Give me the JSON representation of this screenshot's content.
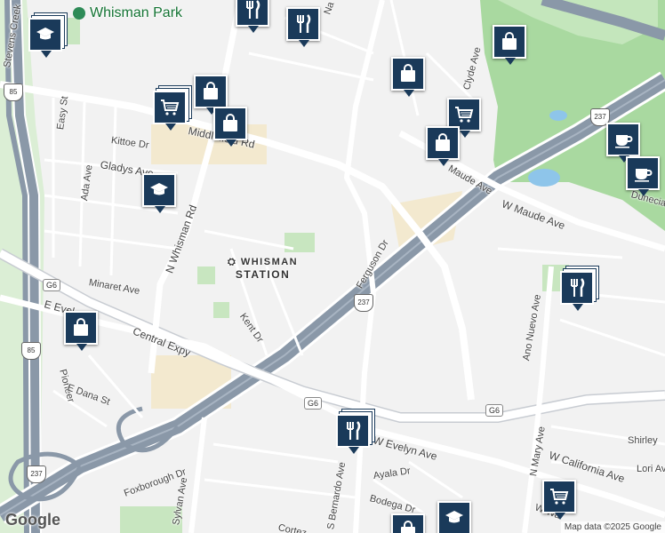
{
  "map": {
    "places": {
      "park": "Whisman Park",
      "station_line1": "WHISMAN",
      "station_line2": "STATION"
    },
    "streets": {
      "middlefield": "Middlefield Rd",
      "kittoe": "Kittoe Dr",
      "gladys": "Gladys Ave",
      "ada": "Ada Ave",
      "easy": "Easy St",
      "n_whisman": "N Whisman Rd",
      "minaret": "Minaret Ave",
      "e_evelyn_left": "E Evel",
      "central": "Central Expy",
      "kent": "Kent Dr",
      "pioneer": "Pioneer",
      "e_dana": "E Dana St",
      "foxborough": "Foxborough Dr",
      "sylvan": "Sylvan Ave",
      "s_bernardo": "S Bernardo Ave",
      "w_evelyn": "W Evelyn Ave",
      "ayala": "Ayala Dr",
      "bodega": "Bodega Dr",
      "cortez": "Cortez",
      "ferguson": "Ferguson Dr",
      "w_maude": "W Maude Ave",
      "maude": "Maude Ave",
      "clyde": "Clyde Ave",
      "ano_nuevo": "Ano Nuevo Ave",
      "n_mary": "N Mary Ave",
      "w_california": "W California Ave",
      "shirley": "Shirley",
      "lori": "Lori Av",
      "w_wash": "W Wa",
      "stevens_creek": "Stevens Creek",
      "na_top": "Na",
      "dunecia": "Dunecia"
    },
    "shields": {
      "hwy85_top": "85",
      "hwy85_bottom": "85",
      "hwy237_top": "237",
      "hwy237_mid": "237",
      "hwy237_bottom": "237",
      "g6_left": "G6",
      "g6_mid": "G6",
      "g6_right": "G6"
    },
    "pins": [
      {
        "name": "school-pin-1",
        "icon": "school"
      },
      {
        "name": "shopping-bag-pin-1",
        "icon": "bag"
      },
      {
        "name": "cart-pin-1",
        "icon": "cart"
      },
      {
        "name": "shopping-bag-pin-2",
        "icon": "bag"
      },
      {
        "name": "restaurant-pin-1",
        "icon": "restaurant"
      },
      {
        "name": "restaurant-pin-2",
        "icon": "restaurant"
      },
      {
        "name": "shopping-bag-pin-3",
        "icon": "bag"
      },
      {
        "name": "shopping-bag-pin-4",
        "icon": "bag"
      },
      {
        "name": "cart-pin-2",
        "icon": "cart"
      },
      {
        "name": "shopping-bag-pin-5",
        "icon": "bag"
      },
      {
        "name": "cafe-pin-1",
        "icon": "cafe"
      },
      {
        "name": "cafe-pin-2",
        "icon": "cafe"
      },
      {
        "name": "school-pin-2",
        "icon": "school"
      },
      {
        "name": "shopping-bag-pin-6",
        "icon": "bag"
      },
      {
        "name": "restaurant-pin-3",
        "icon": "restaurant"
      },
      {
        "name": "restaurant-pin-4",
        "icon": "restaurant"
      },
      {
        "name": "cart-pin-3",
        "icon": "cart"
      },
      {
        "name": "school-pin-3",
        "icon": "school"
      },
      {
        "name": "shopping-bag-pin-7",
        "icon": "bag"
      }
    ],
    "attribution": {
      "logo": "Google",
      "copyright": "Map data ©2025 Google"
    },
    "colors": {
      "pin": "#1a3a5a",
      "freeway": "#8a98a8",
      "park": "#c8e6c0",
      "golf": "#a9d9a0",
      "water": "#8ec5ea",
      "commercial": "#f3e9cf"
    }
  }
}
